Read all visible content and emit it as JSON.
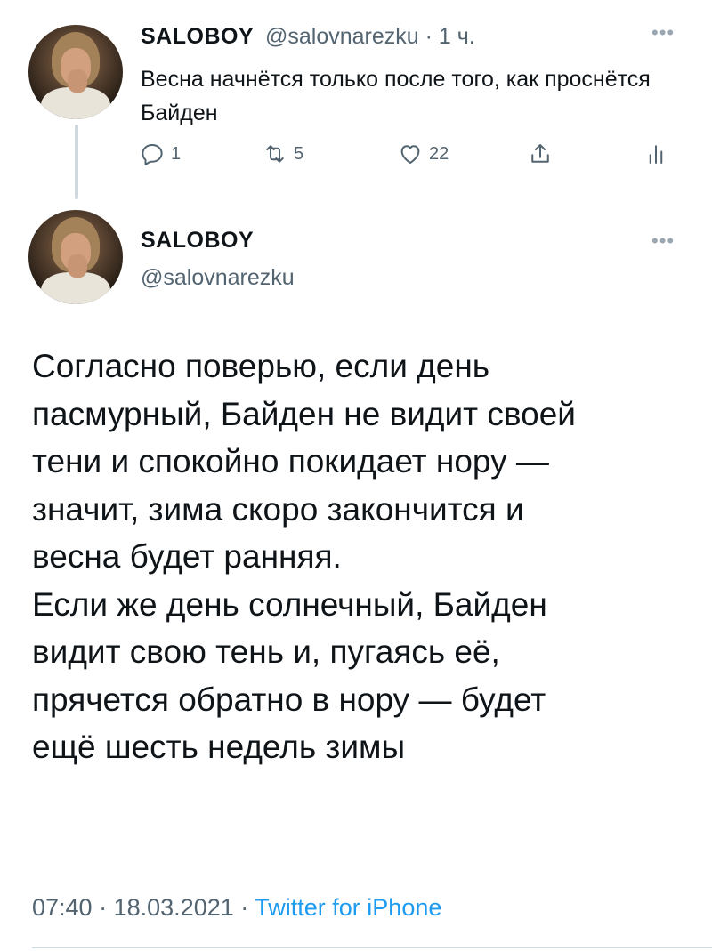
{
  "reply_tweet": {
    "author_name": "SALOBOY",
    "handle": "@salovnarezku",
    "separator": "·",
    "time": "1 ч.",
    "text": "Весна начнётся только после того, как проснётся Байден",
    "more_icon": "more-horizontal-icon",
    "actions": {
      "reply_count": "1",
      "retweet_count": "5",
      "like_count": "22"
    }
  },
  "main_tweet": {
    "author_name": "SALOBOY",
    "handle": "@salovnarezku",
    "more_icon": "more-horizontal-icon",
    "text": "Согласно поверью, если день\nпасмурный, Байден не видит своей\nтени и спокойно покидает нору —\nзначит, зима скоро закончится и\nвесна будет ранняя.\nЕсли же день солнечный, Байден\nвидит свою тень и, пугаясь её,\nпрячется обратно в нору — будет\nещё шесть недель зимы",
    "time": "07:40",
    "separator": "·",
    "date": "18.03.2021",
    "source": "Twitter for iPhone"
  },
  "colors": {
    "text": "#0f1419",
    "secondary": "#536471",
    "accent": "#1d9bf0",
    "divider": "#cfd9de"
  }
}
